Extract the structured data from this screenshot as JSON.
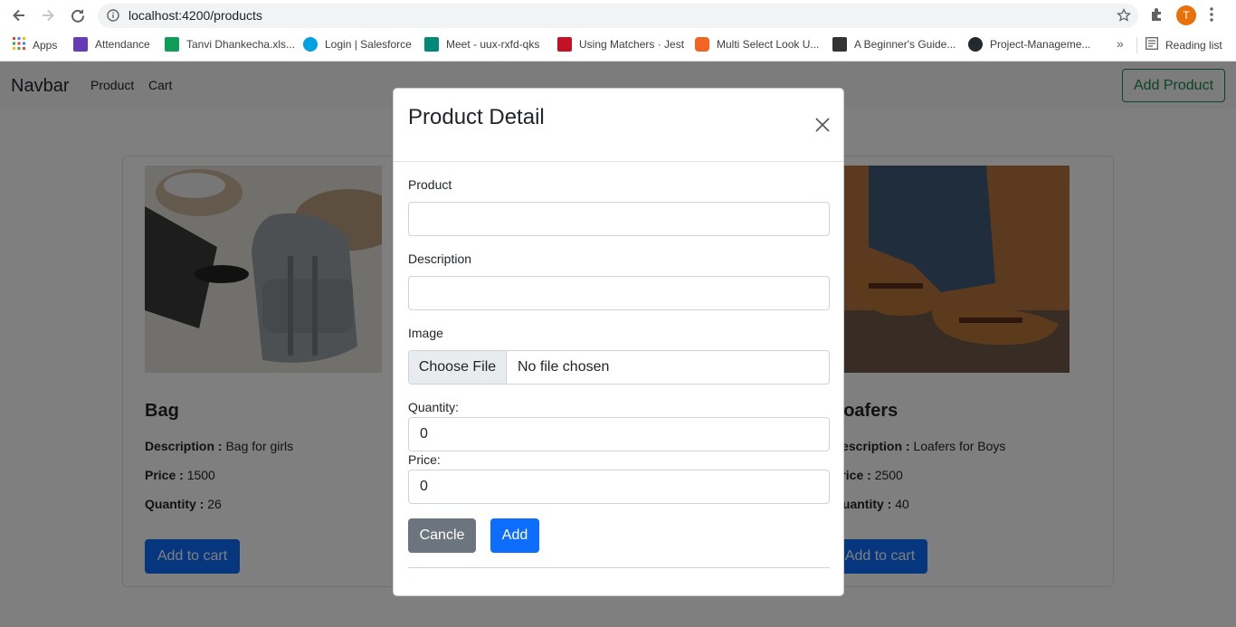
{
  "browser": {
    "url": "localhost:4200/products",
    "avatar_initial": "T",
    "bookmarks": [
      {
        "label": "Apps",
        "color": "#ea4335"
      },
      {
        "label": "Attendance",
        "color": "#673ab7"
      },
      {
        "label": "Tanvi Dhankecha.xls...",
        "color": "#0f9d58"
      },
      {
        "label": "Login | Salesforce",
        "color": "#00a1e0"
      },
      {
        "label": "Meet - uux-rxfd-qks",
        "color": "#00897b"
      },
      {
        "label": "Using Matchers · Jest",
        "color": "#c21325"
      },
      {
        "label": "Multi Select Look U...",
        "color": "#f26522"
      },
      {
        "label": "A Beginner's Guide...",
        "color": "#333333"
      },
      {
        "label": "Project-Manageme...",
        "color": "#24292e"
      }
    ],
    "more": "»",
    "reading_list": "Reading list"
  },
  "navbar": {
    "brand": "Navbar",
    "links": [
      "Product",
      "Cart"
    ],
    "add_product": "Add Product"
  },
  "products": [
    {
      "name": "Bag",
      "description_label": "Description :",
      "description": "Bag for girls",
      "price_label": "Price :",
      "price": "1500",
      "quantity_label": "Quantity :",
      "quantity": "26",
      "button": "Add to cart"
    },
    {
      "name": "Loafers",
      "description_label": "Description :",
      "description": "Loafers for Boys",
      "price_label": "Price :",
      "price": "2500",
      "quantity_label": "Quantity :",
      "quantity": "40",
      "button": "Add to cart"
    }
  ],
  "modal": {
    "title": "Product Detail",
    "product_label": "Product",
    "product_value": "",
    "description_label": "Description",
    "description_value": "",
    "image_label": "Image",
    "choose_file": "Choose File",
    "no_file": "No file chosen",
    "quantity_label": "Quantity:",
    "quantity_value": "0",
    "price_label": "Price:",
    "price_value": "0",
    "cancel_button": "Cancle",
    "add_button": "Add"
  },
  "colors": {
    "primary": "#0d6efd",
    "secondary": "#6c757d",
    "success": "#198754"
  }
}
